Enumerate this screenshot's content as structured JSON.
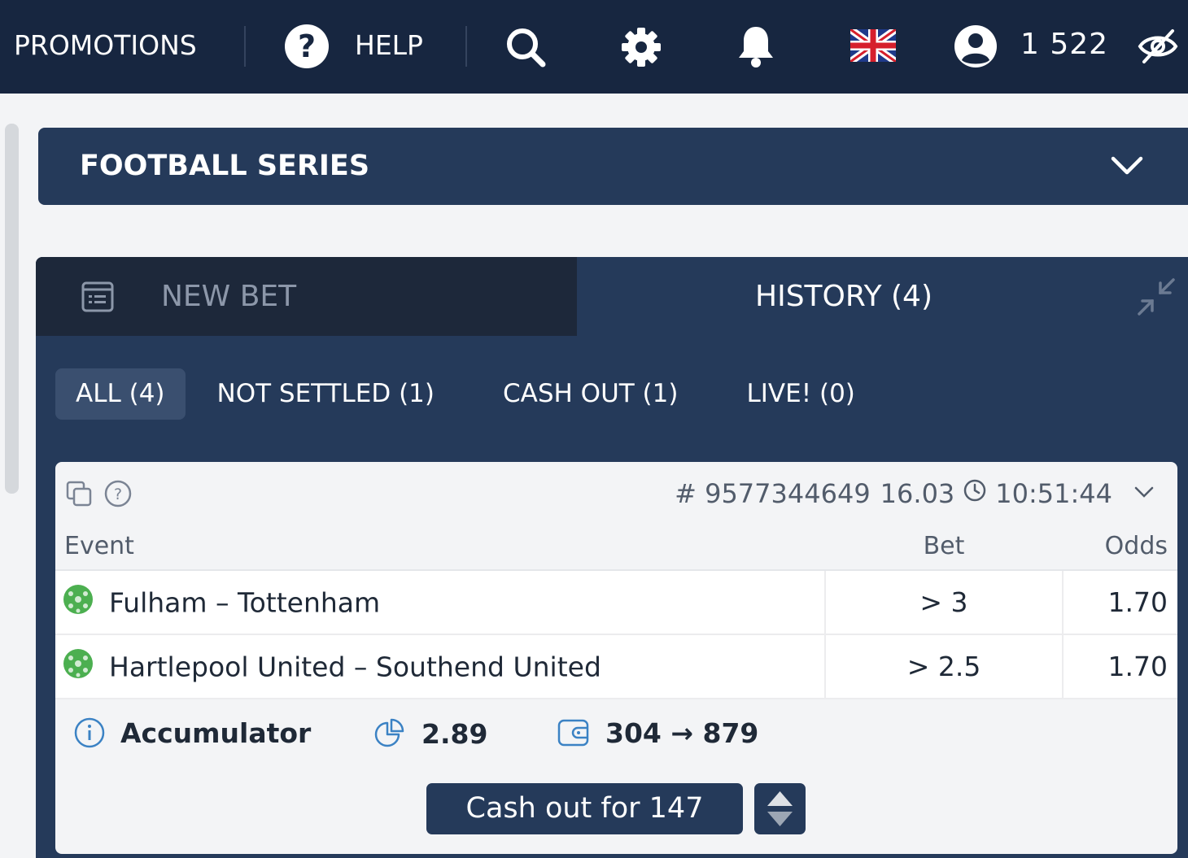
{
  "topbar": {
    "promotions": "PROMOTIONS",
    "help_label": "HELP",
    "help_icon": "?",
    "balance": "1 522",
    "icons": [
      "help-icon",
      "search-icon",
      "gear-icon",
      "bell-icon",
      "uk-flag-icon",
      "user-icon",
      "eye-off-icon"
    ]
  },
  "series": {
    "title": "FOOTBALL SERIES"
  },
  "betslip": {
    "tabs": {
      "new_bet": "NEW BET",
      "history": "HISTORY (4)"
    },
    "filters": [
      {
        "label": "ALL (4)",
        "active": true
      },
      {
        "label": "NOT SETTLED (1)",
        "active": false
      },
      {
        "label": "CASH OUT (1)",
        "active": false
      },
      {
        "label": "LIVE! (0)",
        "active": false
      }
    ],
    "card": {
      "id": "# 9577344649",
      "date": "16.03",
      "time": "10:51:44",
      "columns": {
        "event": "Event",
        "bet": "Bet",
        "odds": "Odds"
      },
      "legs": [
        {
          "event": "Fulham – Tottenham",
          "bet": "> 3",
          "odds": "1.70"
        },
        {
          "event": "Hartlepool United – Southend United",
          "bet": "> 2.5",
          "odds": "1.70"
        }
      ],
      "type": "Accumulator",
      "total_odds": "2.89",
      "stake_return": "304 → 879",
      "cashout_label": "Cash out for 147"
    }
  },
  "colors": {
    "topbar": "#172640",
    "panel": "#253a5a",
    "tab_inactive": "#1d283a",
    "accent_icon": "#3b82c4",
    "ball_green": "#4caf50"
  }
}
